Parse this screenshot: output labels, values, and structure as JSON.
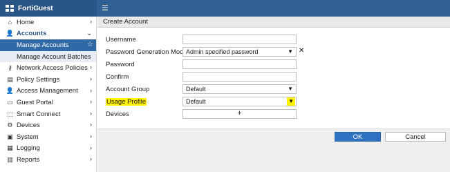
{
  "app": {
    "title": "FortiGuest",
    "logo_icon": "grid-logo-icon",
    "menu_icon": "hamburger-icon"
  },
  "sidebar": {
    "items": [
      {
        "label": "Home",
        "icon": "home-icon",
        "glyph": "🏠",
        "chevron": "›"
      },
      {
        "label": "Accounts",
        "icon": "user-icon",
        "glyph": "👤",
        "chevron": "⌄",
        "open": true
      },
      {
        "label": "Manage Accounts",
        "sub": true,
        "active": true,
        "star": "☆"
      },
      {
        "label": "Manage Account Batches",
        "sub": true
      },
      {
        "label": "Network Access Policies",
        "icon": "key-icon",
        "glyph": "⚷",
        "chevron": "›"
      },
      {
        "label": "Policy Settings",
        "icon": "document-icon",
        "glyph": "▤",
        "chevron": "›"
      },
      {
        "label": "Access Management",
        "icon": "user-icon",
        "glyph": "👤",
        "chevron": "›"
      },
      {
        "label": "Guest Portal",
        "icon": "monitor-icon",
        "glyph": "▭",
        "chevron": "›"
      },
      {
        "label": "Smart Connect",
        "icon": "connect-icon",
        "glyph": "⬚",
        "chevron": "›"
      },
      {
        "label": "Devices",
        "icon": "devices-icon",
        "glyph": "⚙",
        "chevron": "›"
      },
      {
        "label": "System",
        "icon": "system-icon",
        "glyph": "▣",
        "chevron": "›"
      },
      {
        "label": "Logging",
        "icon": "chart-icon",
        "glyph": "▦",
        "chevron": "›"
      },
      {
        "label": "Reports",
        "icon": "report-icon",
        "glyph": "▥",
        "chevron": "›"
      }
    ]
  },
  "main": {
    "breadcrumb": "Create Account",
    "form": {
      "username": {
        "label": "Username",
        "value": ""
      },
      "password_mode": {
        "label": "Password Generation Mode",
        "value": "Admin specified password",
        "clear": "✕"
      },
      "password": {
        "label": "Password",
        "value": ""
      },
      "confirm": {
        "label": "Confirm",
        "value": ""
      },
      "account_group": {
        "label": "Account Group",
        "value": "Default"
      },
      "usage_profile": {
        "label": "Usage Profile",
        "value": "Default"
      },
      "devices": {
        "label": "Devices",
        "add": "+"
      }
    },
    "buttons": {
      "ok": "OK",
      "cancel": "Cancel"
    }
  },
  "colors": {
    "topbar": "#2f5f93",
    "active": "#2f6aa6",
    "primary_button": "#2f72c2",
    "highlight": "#fff200"
  }
}
